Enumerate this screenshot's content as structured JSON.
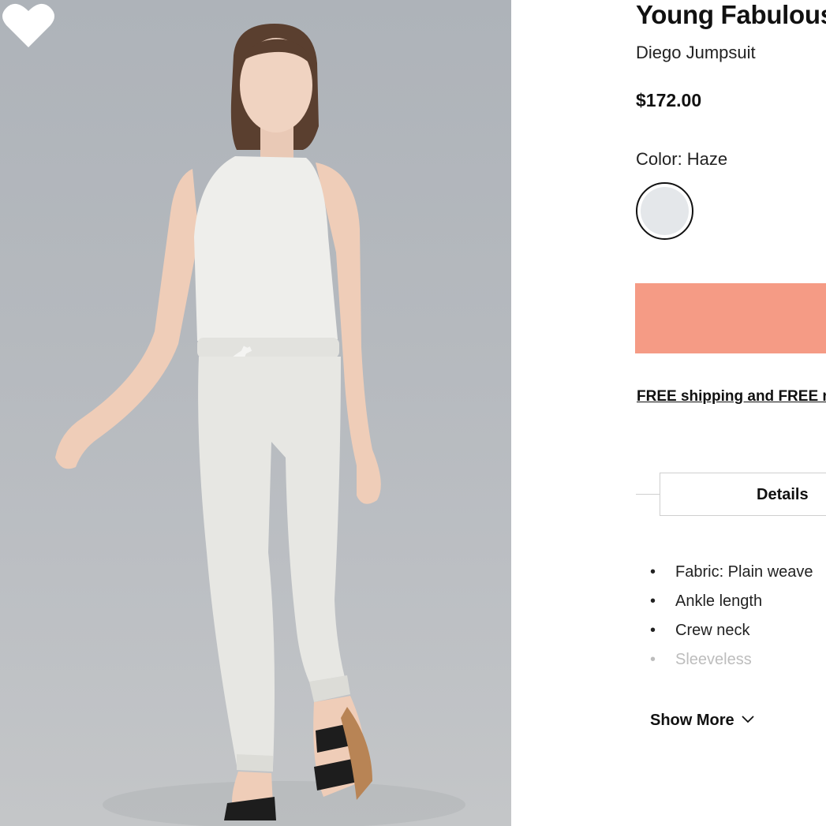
{
  "product": {
    "brand": "Young Fabulous",
    "name": "Diego Jumpsuit",
    "price": "$172.00",
    "color_label": "Color: Haze",
    "selected_swatch_color": "#e4e7ea",
    "shipping_text": "FREE shipping and FREE returns"
  },
  "tabs": {
    "details_label": "Details"
  },
  "details": {
    "items": [
      "Fabric: Plain weave",
      "Ankle length",
      "Crew neck",
      "Sleeveless"
    ],
    "show_more_label": "Show More"
  },
  "icons": {
    "wishlist": "heart-icon",
    "show_more": "chevron-down-icon"
  },
  "colors": {
    "accent_button": "#f59b85",
    "image_background": "#b5b9be",
    "text": "#111111"
  }
}
